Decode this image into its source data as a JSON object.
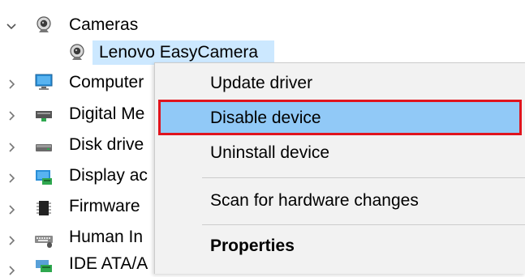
{
  "tree": {
    "cameras": {
      "label": "Cameras",
      "icon": "webcam-icon",
      "expanded": true
    },
    "camera_child": {
      "label": "Lenovo EasyCamera",
      "icon": "webcam-icon",
      "selected": true
    },
    "items": [
      {
        "label": "Computer",
        "icon": "monitor-icon"
      },
      {
        "label": "Digital Me",
        "icon": "network-card-icon"
      },
      {
        "label": "Disk drive",
        "icon": "disk-drive-icon"
      },
      {
        "label": "Display ac",
        "icon": "display-adapter-icon"
      },
      {
        "label": "Firmware",
        "icon": "chip-icon"
      },
      {
        "label": "Human In",
        "icon": "keyboard-mouse-icon"
      },
      {
        "label": "IDE ATA/A",
        "icon": "ide-controller-icon"
      }
    ]
  },
  "context_menu": {
    "items": [
      {
        "label": "Update driver"
      },
      {
        "label": "Disable device",
        "highlighted": true
      },
      {
        "label": "Uninstall device"
      },
      {
        "label": "Scan for hardware changes"
      },
      {
        "label": "Properties",
        "bold": true
      }
    ]
  },
  "colors": {
    "selection": "#cce8ff",
    "menu_hover": "#91c9f7",
    "menu_background": "#f2f2f2",
    "annotation_border": "#e0141e"
  }
}
